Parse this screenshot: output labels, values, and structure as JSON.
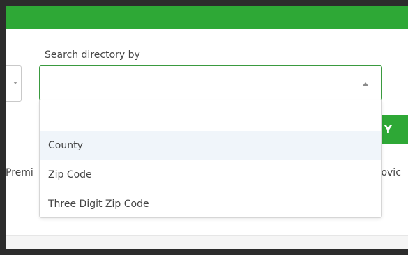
{
  "form": {
    "search_by_label": "Search directory by",
    "selected_value": "",
    "button_fragment": "Y",
    "background_left_text": "Premi",
    "background_right_text": "rovic"
  },
  "dropdown": {
    "options": [
      "",
      "County",
      "Zip Code",
      "Three Digit Zip Code"
    ],
    "highlighted_option": "County"
  },
  "colors": {
    "brand_green": "#2ea836",
    "select_border": "#3a9a3f",
    "highlight": "#f0f5fa"
  },
  "icons": {
    "select_caret": "caret-up-icon",
    "left_select_caret": "chevron-down-icon"
  }
}
